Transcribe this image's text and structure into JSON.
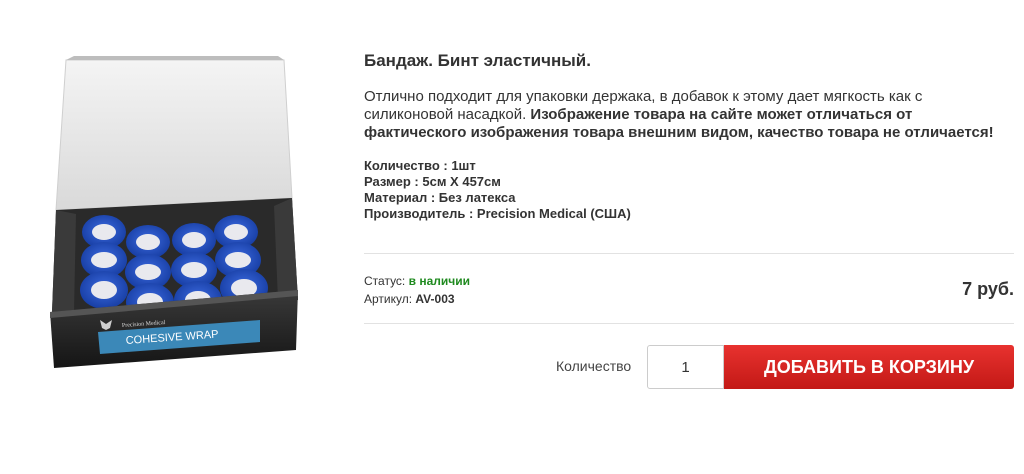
{
  "product": {
    "image_alt": "Бандаж. Бинт эластичный.",
    "box_brand": "Precision Medical",
    "box_label": "COHESIVE WRAP",
    "title": "Бандаж. Бинт эластичный.",
    "description_plain": "Отлично подходит для упаковки держака, в добавок к этому дает мягкость как с силиконовой насадкой. ",
    "description_bold": "Изображение товара на сайте может отличаться от фактического изображения товара внешним видом, качество товара не отличается!",
    "specs": [
      "Количество : 1шт",
      "Размер : 5см X 457см",
      "Материал : Без латекса",
      "Производитель : Precision Medical (США)"
    ],
    "status_label": "Статус: ",
    "status_value": "в наличии",
    "article_label": "Артикул: ",
    "article_value": "AV-003",
    "price": "7 руб."
  },
  "cart": {
    "quantity_label": "Количество",
    "quantity_value": "1",
    "add_button_label": "Добавить в корзину"
  },
  "colors": {
    "status_in_stock": "#1f8a1f",
    "button_red": "#d42421",
    "wrap_blue": "#1b48c0"
  }
}
